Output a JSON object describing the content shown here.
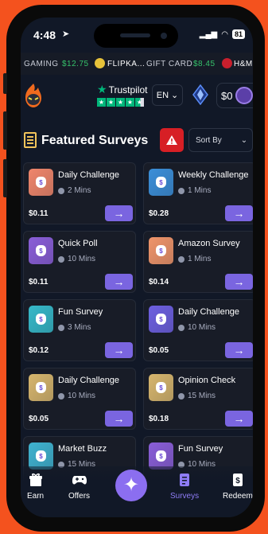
{
  "status": {
    "time": "4:48",
    "battery": "81"
  },
  "ticker": [
    {
      "name": "GAMING",
      "amount": "$12.75"
    },
    {
      "name": "FLIPKA...",
      "amount": ""
    },
    {
      "name": "GIFT CARD",
      "amount": "$8.45"
    },
    {
      "name": "H&M",
      "amount": ""
    }
  ],
  "header": {
    "trustpilot_label": "Trustpilot",
    "language": "EN",
    "balance": "$0"
  },
  "section": {
    "title": "Featured Surveys",
    "sort_label": "Sort By"
  },
  "surveys": [
    {
      "name": "Daily Challenge",
      "duration": "2 Mins",
      "reward": "$0.11",
      "color": "#f0866b"
    },
    {
      "name": "Weekly Challenge",
      "duration": "1 Mins",
      "reward": "$0.28",
      "color": "#3b8fd9"
    },
    {
      "name": "Quick Poll",
      "duration": "10 Mins",
      "reward": "$0.11",
      "color": "#8a5ed8"
    },
    {
      "name": "Amazon Survey",
      "duration": "1 Mins",
      "reward": "$0.14",
      "color": "#f0956a"
    },
    {
      "name": "Fun Survey",
      "duration": "3 Mins",
      "reward": "$0.12",
      "color": "#36b9c9"
    },
    {
      "name": "Daily Challenge",
      "duration": "10 Mins",
      "reward": "$0.05",
      "color": "#6d5fe0"
    },
    {
      "name": "Daily Challenge",
      "duration": "10 Mins",
      "reward": "$0.05",
      "color": "#d7b66d"
    },
    {
      "name": "Opinion Check",
      "duration": "15 Mins",
      "reward": "$0.18",
      "color": "#d7b66d"
    },
    {
      "name": "Market Buzz",
      "duration": "15 Mins",
      "reward": "",
      "color": "#3fb3d0"
    },
    {
      "name": "Fun Survey",
      "duration": "10 Mins",
      "reward": "",
      "color": "#8a5ed8"
    }
  ],
  "nav": {
    "earn": "Earn",
    "offers": "Offers",
    "surveys": "Surveys",
    "redeem": "Redeem",
    "active_color": "#8e7cf5"
  },
  "colors": {
    "accent": "#7a65e0",
    "background": "#111827",
    "frame": "#f4521e",
    "trustpilot": "#00b67a"
  }
}
